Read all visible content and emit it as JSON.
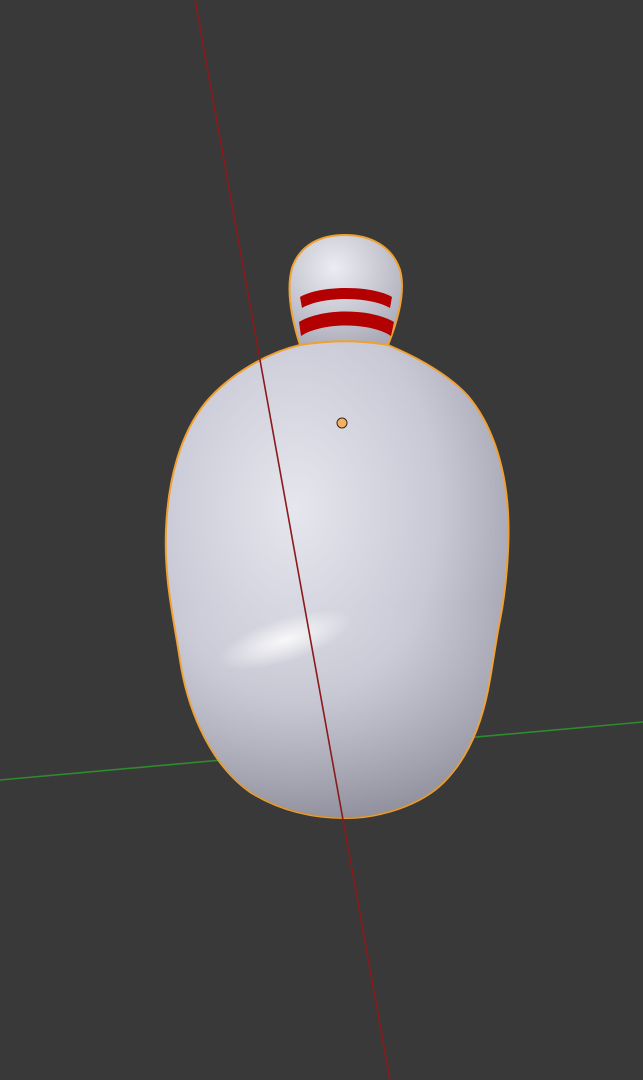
{
  "viewport": {
    "background": "#393939",
    "axes": {
      "x_axis_color": "#8b1a1a",
      "y_axis_color": "#2e8b2e"
    },
    "object": {
      "kind": "bowling-pin-mesh",
      "selected": true,
      "selection_outline_color": "#f0a030",
      "body_color": "#c8c8d4",
      "stripe_color": "#b30000",
      "stripe_count": 2,
      "origin_marker_color": "#f4b066"
    }
  }
}
